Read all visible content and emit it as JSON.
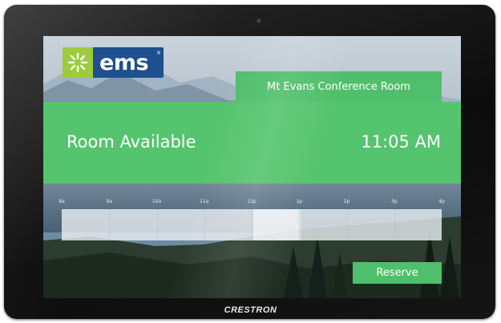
{
  "device": {
    "brand": "CRESTRON"
  },
  "app": {
    "logo_text": "ems",
    "logo_reg": "®",
    "room_name": "Mt Evans Conference Room",
    "status": "Room Available",
    "current_time": "11:05 AM"
  },
  "timeline": {
    "ticks": [
      "8a",
      "9a",
      "10a",
      "11a",
      "12p",
      "1p",
      "2p",
      "3p",
      "4p"
    ],
    "current_hour_fraction": 0.51
  },
  "actions": {
    "reserve_label": "Reserve"
  },
  "colors": {
    "accent_green": "#55c46e",
    "logo_blue": "#1e4f8e",
    "logo_green": "#9ccb3b"
  }
}
